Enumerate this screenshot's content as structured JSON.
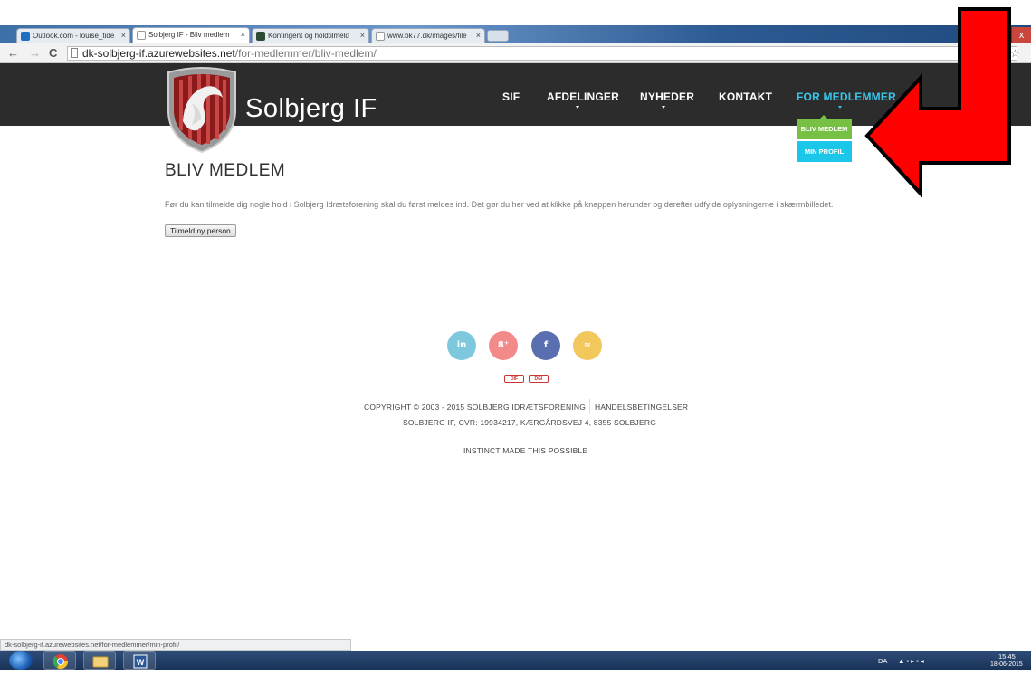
{
  "browser": {
    "tabs": [
      {
        "label": "Outlook.com - louise_tide",
        "close": "×",
        "icon_color": "#1f6fc4"
      },
      {
        "label": "Solbjerg IF - Bliv medlem",
        "close": "×",
        "icon_color": "#ffffff"
      },
      {
        "label": "Kontingent og holdtilmeld",
        "close": "×",
        "icon_color": "#2c4c33"
      },
      {
        "label": "www.bk77.dk/images/file",
        "close": "×",
        "icon_color": "#ffffff"
      }
    ],
    "window_close": "x",
    "back": "←",
    "forward": "→",
    "reload": "C",
    "url_host": "dk-solbjerg-if.azurewebsites.net",
    "url_path": "/for-medlemmer/bliv-medlem/",
    "star": "☆",
    "status_url": "dk-solbjerg-if.azurewebsites.net/for-medlemmer/min-profil/"
  },
  "site": {
    "brand": "Solbjerg IF",
    "nav": [
      {
        "label": "SIF"
      },
      {
        "label": "AFDELINGER"
      },
      {
        "label": "NYHEDER"
      },
      {
        "label": "KONTAKT"
      },
      {
        "label": "FOR MEDLEMMER"
      }
    ],
    "dropdown": [
      "BLIV MEDLEM",
      "MIN PROFIL"
    ],
    "colors": {
      "header": "#2c2c2c",
      "active_nav": "#39c6ea",
      "bliv_medlem": "#76c043",
      "min_profil": "#1cc6e8",
      "arrow": "#ff0000"
    }
  },
  "main": {
    "title": "BLIV MEDLEM",
    "intro": "Før du kan tilmelde dig nogle hold i Solbjerg Idrætsforening skal du først meldes ind. Det gør du her ved at klikke på knappen herunder og derefter udfylde oplysningerne i skærmbilledet.",
    "register_button": "Tilmeld ny person"
  },
  "footer": {
    "social": [
      {
        "icon": "linkedin-icon",
        "glyph": "in",
        "color": "#7ec8dd"
      },
      {
        "icon": "google-plus-icon",
        "glyph": "8⁺",
        "color": "#f28a8a"
      },
      {
        "icon": "facebook-icon",
        "glyph": "f",
        "color": "#5a6fb0"
      },
      {
        "icon": "rss-icon",
        "glyph": "≈",
        "color": "#f2c75c"
      }
    ],
    "badges": [
      "DIF",
      "DGI"
    ],
    "copyright": "COPYRIGHT © 2003 - 2015 SOLBJERG IDRÆTSFORENING",
    "terms": "HANDELSBETINGELSER",
    "address": "SOLBJERG IF, CVR: 19934217, KÆRGÅRDSVEJ 4, 8355 SOLBJERG",
    "credit": "INSTINCT MADE THIS POSSIBLE"
  },
  "taskbar": {
    "lang": "DA",
    "time": "15:45",
    "date": "18-06-2015"
  }
}
